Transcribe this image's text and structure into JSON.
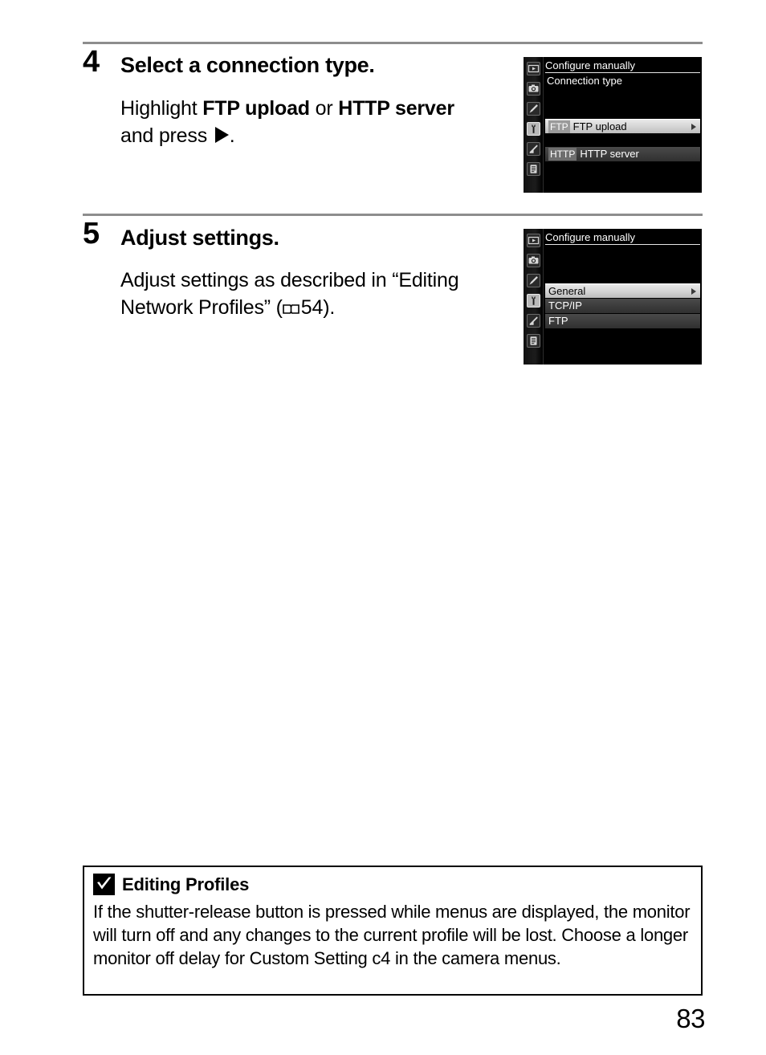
{
  "page": {
    "number": "83"
  },
  "steps": [
    {
      "number": "4",
      "title": "Select a connection type.",
      "body_prefix": "Highlight ",
      "body_bold_1": "FTP upload",
      "body_mid": " or ",
      "body_bold_2": "HTTP server",
      "body_suffix_line": "and press ",
      "body_end": "."
    },
    {
      "number": "5",
      "title": "Adjust settings.",
      "body_line_1": "Adjust settings as described in “Editing",
      "body_line_2_pre": "Network Profiles” (",
      "body_page_ref": "54",
      "body_line_2_post": ")."
    }
  ],
  "menus": [
    {
      "name": "connection-type-menu",
      "header": "Configure manually",
      "subheader": "Connection type",
      "sidebar_icons": [
        "playback-icon",
        "camera-shooting-icon",
        "pencil-retouch-icon",
        "wrench-setup-icon",
        "pencil-ruler-custom-icon",
        "recent-settings-icon"
      ],
      "selected_sidebar_icon": "wrench-setup-icon",
      "rows": [
        {
          "tag": "FTP",
          "label": "FTP upload",
          "state": "highlighted",
          "arrow": true
        },
        {
          "tag": "HTTP",
          "label": "HTTP server",
          "state": "dim",
          "arrow": false
        }
      ]
    },
    {
      "name": "adjust-settings-menu",
      "header": "Configure manually",
      "subheader": "",
      "sidebar_icons": [
        "playback-icon",
        "camera-shooting-icon",
        "pencil-retouch-icon",
        "wrench-setup-icon",
        "pencil-ruler-custom-icon",
        "recent-settings-icon"
      ],
      "selected_sidebar_icon": "wrench-setup-icon",
      "rows": [
        {
          "tag": "",
          "label": "General",
          "state": "highlighted",
          "arrow": true
        },
        {
          "tag": "",
          "label": "TCP/IP",
          "state": "dim",
          "arrow": false
        },
        {
          "tag": "",
          "label": "FTP",
          "state": "dim",
          "arrow": false
        }
      ]
    }
  ],
  "note": {
    "icon": "caution-checkmark-icon",
    "title": "Editing Profiles",
    "text": "If the shutter-release button is pressed while menus are displayed, the monitor will turn off and any changes to the current profile will be lost. Choose a longer monitor off delay for Custom Setting c4 in the camera menus."
  },
  "colors": {
    "rule": "#8d8d8d",
    "menu_background": "#000000",
    "row_highlight": "#d3d3d3",
    "row_dim": "#3a3a3a",
    "text": "#000000"
  }
}
